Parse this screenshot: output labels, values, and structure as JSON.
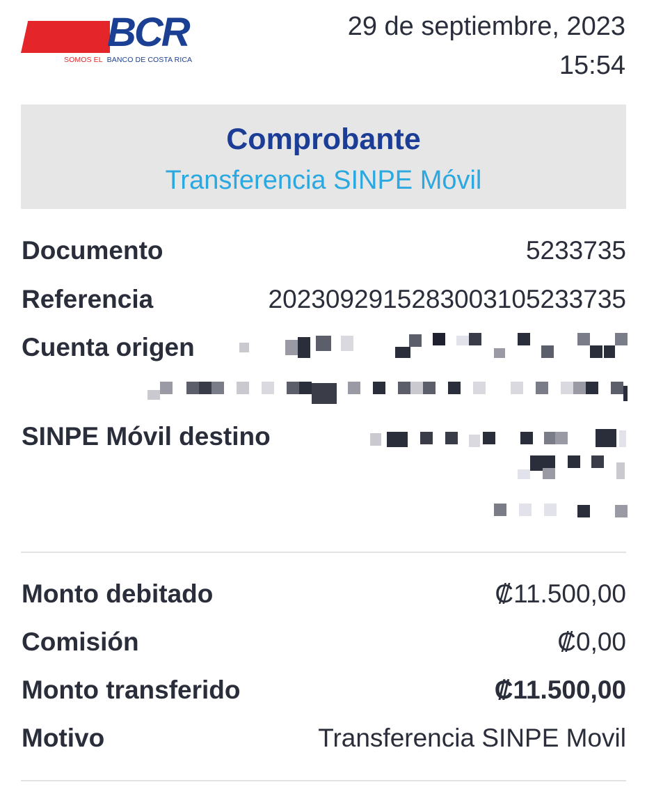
{
  "header": {
    "logo_text": "BCR",
    "logo_tag_left": "SOMOS EL",
    "logo_tag_right": "BANCO DE COSTA RICA",
    "date": "29 de septiembre, 2023",
    "time": "15:54"
  },
  "title": {
    "heading": "Comprobante",
    "subheading": "Transferencia SINPE Móvil"
  },
  "details": {
    "documento_label": "Documento",
    "documento_value": "5233735",
    "referencia_label": "Referencia",
    "referencia_value": "2023092915283003105233735",
    "cuenta_origen_label": "Cuenta origen",
    "sinpe_destino_label": "SINPE Móvil destino"
  },
  "amounts": {
    "monto_debitado_label": "Monto debitado",
    "monto_debitado_value": "₡11.500,00",
    "comision_label": "Comisión",
    "comision_value": "₡0,00",
    "monto_transferido_label": "Monto transferido",
    "monto_transferido_value": "₡11.500,00",
    "motivo_label": "Motivo",
    "motivo_value": "Transferencia SINPE Movil"
  },
  "colors": {
    "brand_blue": "#1c3d96",
    "brand_red": "#e4262a",
    "subtitle_blue": "#2aa8df",
    "text": "#2a2d3a",
    "title_bg": "#e6e6e6"
  }
}
